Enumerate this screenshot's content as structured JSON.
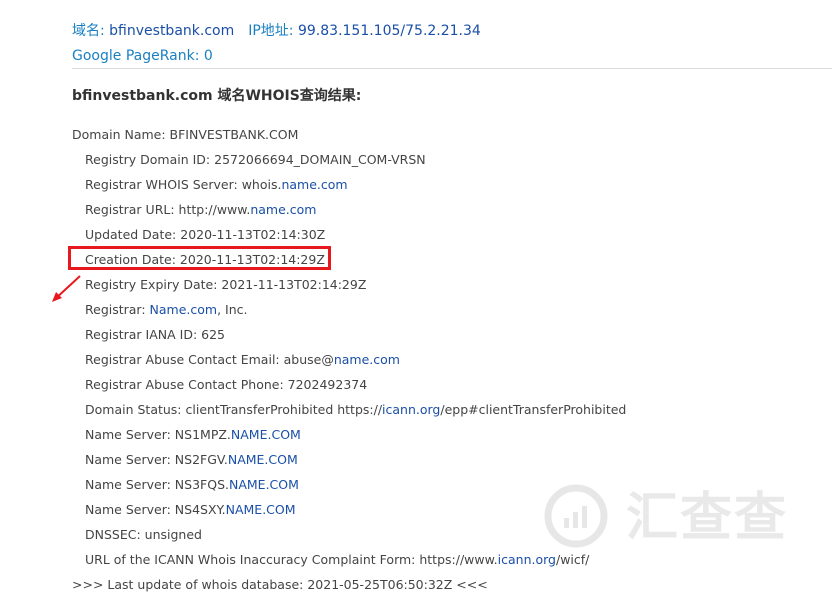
{
  "header": {
    "domain_label": "域名: ",
    "domain_value": "bfinvestbank.com",
    "ip_label": "IP地址: ",
    "ip_value": "99.83.151.105/75.2.21.34",
    "pagerank_label": "Google PageRank: ",
    "pagerank_value": "0"
  },
  "title": "bfinvestbank.com 域名WHOIS查询结果:",
  "whois": {
    "domain_name": "Domain Name: BFINVESTBANK.COM",
    "registry_domain_id": "Registry Domain ID: 2572066694_DOMAIN_COM-VRSN",
    "whois_server_prefix": "Registrar WHOIS Server: whois.",
    "whois_server_link": "name.com",
    "registrar_url_prefix": "Registrar URL: http://www.",
    "registrar_url_link": "name.com",
    "updated_date": "Updated Date: 2020-11-13T02:14:30Z",
    "creation_date": "Creation Date: 2020-11-13T02:14:29Z",
    "expiry_date": "Registry Expiry Date: 2021-11-13T02:14:29Z",
    "registrar_prefix": "Registrar: ",
    "registrar_link": "Name.com",
    "registrar_suffix": ", Inc.",
    "iana_id": "Registrar IANA ID: 625",
    "abuse_email_prefix": "Registrar Abuse Contact Email: abuse@",
    "abuse_email_link": "name.com",
    "abuse_phone": "Registrar Abuse Contact Phone: 7202492374",
    "status_prefix": "Domain Status: clientTransferProhibited https://",
    "status_link": "icann.org",
    "status_suffix": "/epp#clientTransferProhibited",
    "name_servers": [
      {
        "prefix": "Name Server: NS1MPZ.",
        "link": "NAME.COM"
      },
      {
        "prefix": "Name Server: NS2FGV.",
        "link": "NAME.COM"
      },
      {
        "prefix": "Name Server: NS3FQS.",
        "link": "NAME.COM"
      },
      {
        "prefix": "Name Server: NS4SXY.",
        "link": "NAME.COM"
      }
    ],
    "dnssec": "DNSSEC: unsigned",
    "icann_form_prefix": "URL of the ICANN Whois Inaccuracy Complaint Form: https://www.",
    "icann_form_link": "icann.org",
    "icann_form_suffix": "/wicf/",
    "last_update": ">>> Last update of whois database: 2021-05-25T06:50:32Z <<<"
  },
  "watermark": {
    "text": "汇查查",
    "icon": "bar-chart-circle-icon"
  },
  "annotation": {
    "highlight_color": "#e8191e",
    "arrow_icon": "red-arrow-icon"
  }
}
